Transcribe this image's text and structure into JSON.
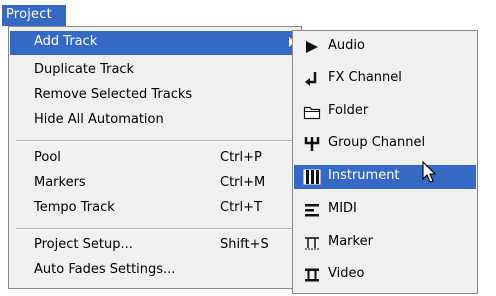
{
  "menubar": {
    "project_label": "Project"
  },
  "main_menu": {
    "items": [
      {
        "label": "Add Track",
        "shortcut": ""
      },
      {
        "label": "Duplicate Track",
        "shortcut": ""
      },
      {
        "label": "Remove Selected Tracks",
        "shortcut": ""
      },
      {
        "label": "Hide All Automation",
        "shortcut": ""
      },
      {
        "label": "Pool",
        "shortcut": "Ctrl+P"
      },
      {
        "label": "Markers",
        "shortcut": "Ctrl+M"
      },
      {
        "label": "Tempo Track",
        "shortcut": "Ctrl+T"
      },
      {
        "label": "Project Setup...",
        "shortcut": "Shift+S"
      },
      {
        "label": "Auto Fades Settings...",
        "shortcut": ""
      }
    ]
  },
  "submenu": {
    "items": [
      {
        "label": "Audio",
        "icon": "play-triangle-icon"
      },
      {
        "label": "FX Channel",
        "icon": "fx-return-arrow-icon"
      },
      {
        "label": "Folder",
        "icon": "folder-icon"
      },
      {
        "label": "Group Channel",
        "icon": "group-fork-icon"
      },
      {
        "label": "Instrument",
        "icon": "piano-keys-icon"
      },
      {
        "label": "MIDI",
        "icon": "midi-lines-icon"
      },
      {
        "label": "Marker",
        "icon": "marker-icon"
      },
      {
        "label": "Video",
        "icon": "video-film-icon"
      }
    ]
  },
  "colors": {
    "highlight": "#3569c4",
    "menu_bg": "#f0f0f0"
  }
}
